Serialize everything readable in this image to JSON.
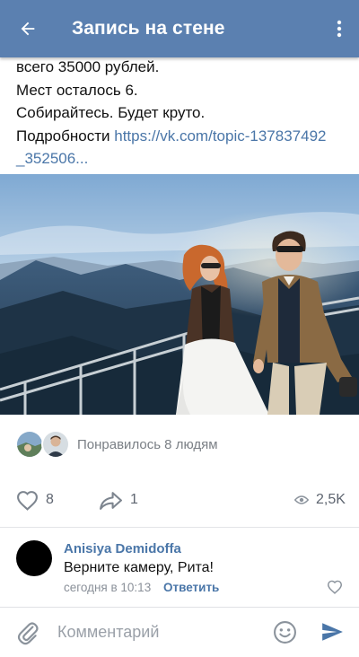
{
  "header": {
    "title": "Запись на стене",
    "back_icon": "arrow-left-icon",
    "menu_icon": "more-vertical-icon",
    "bg_color": "#5b80b0"
  },
  "post": {
    "lines": [
      "всего 35000 рублей.",
      "Мест осталось 6.",
      "Собирайтесь. Будет круто."
    ],
    "details_label": "Подробности",
    "link_part1": "https://vk.com/topic-137837492",
    "link_part2": "_352506..."
  },
  "likers": {
    "text": "Понравилось 8 людям"
  },
  "actions": {
    "likes": "8",
    "shares": "1",
    "views": "2,5K"
  },
  "comment": {
    "author": "Anisiya Demidoffa",
    "text": "Верните камеру, Рита!",
    "time": "сегодня в 10:13",
    "reply_label": "Ответить"
  },
  "composer": {
    "placeholder": "Комментарий",
    "icons": [
      "paperclip-icon",
      "smile-icon",
      "send-icon"
    ]
  },
  "colors": {
    "accent": "#4a76a8",
    "muted": "#7a7f85"
  }
}
